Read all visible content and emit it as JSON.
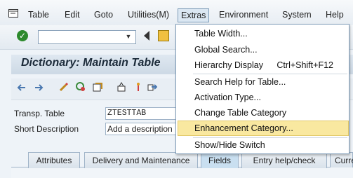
{
  "menubar": {
    "items": [
      {
        "label": "Table"
      },
      {
        "label": "Edit"
      },
      {
        "label": "Goto"
      },
      {
        "label": "Utilities(M)"
      },
      {
        "label": "Extras"
      },
      {
        "label": "Environment"
      },
      {
        "label": "System"
      },
      {
        "label": "Help"
      }
    ]
  },
  "toolbar": {
    "command_value": ""
  },
  "title": "Dictionary: Maintain Table",
  "fields": {
    "transp_table": {
      "label": "Transp. Table",
      "value": "ZTESTTAB"
    },
    "short_description": {
      "label": "Short Description",
      "value": "Add a description"
    }
  },
  "tabs": [
    {
      "label": "Attributes"
    },
    {
      "label": "Delivery and Maintenance"
    },
    {
      "label": "Fields"
    },
    {
      "label": "Entry help/check"
    },
    {
      "label": "Curre"
    }
  ],
  "extras_menu": {
    "items": [
      {
        "label": "Table Width..."
      },
      {
        "label": "Global Search..."
      },
      {
        "label": "Hierarchy Display",
        "shortcut": "Ctrl+Shift+F12"
      },
      {
        "label": "Search Help for Table..."
      },
      {
        "label": "Activation Type..."
      },
      {
        "label": "Change Table Category"
      },
      {
        "label": "Enhancement Category..."
      },
      {
        "label": "Show/Hide Switch"
      }
    ],
    "highlighted": "Enhancement Category..."
  },
  "colors": {
    "highlight": "#f9e8a0",
    "accent": "#7f9db9"
  }
}
